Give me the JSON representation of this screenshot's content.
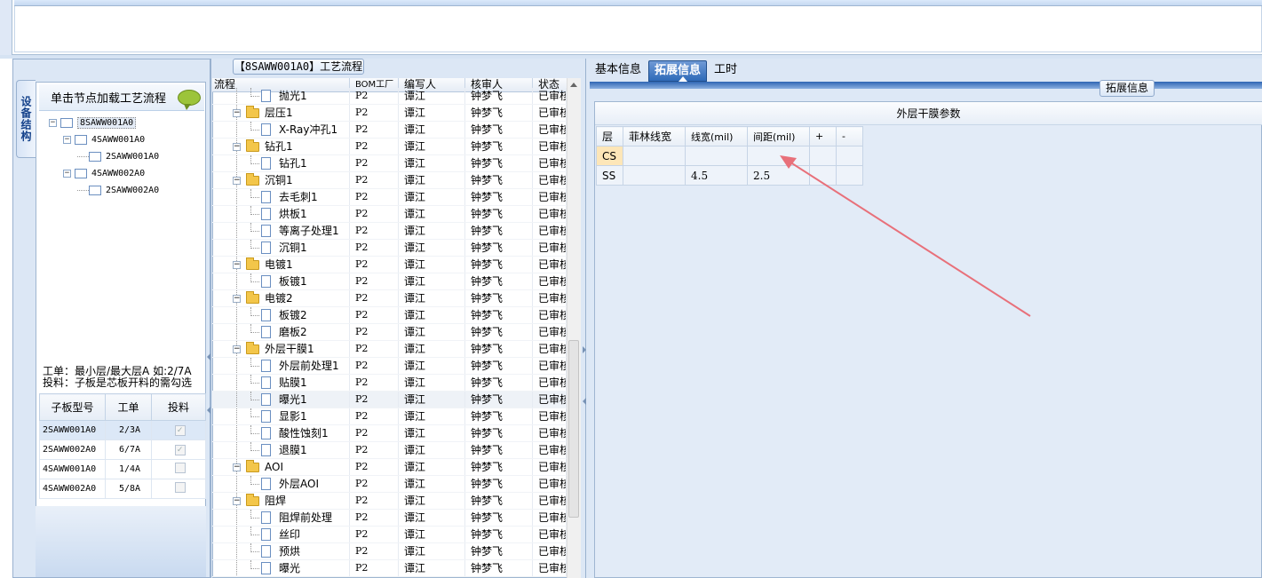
{
  "left_panel": {
    "vertical_tab": "设备结构",
    "tree_header": "单击节点加载工艺流程",
    "tree": [
      {
        "label": "8SAWW001A0",
        "level": 0,
        "expandable": true,
        "selected": true
      },
      {
        "label": "4SAWW001A0",
        "level": 1,
        "expandable": true
      },
      {
        "label": "2SAWW001A0",
        "level": 2,
        "expandable": false
      },
      {
        "label": "4SAWW002A0",
        "level": 1,
        "expandable": true
      },
      {
        "label": "2SAWW002A0",
        "level": 2,
        "expandable": false
      }
    ],
    "hint_line1": "工单：最小层/最大层A 如:2/7A",
    "hint_line2": "投料：子板是芯板开料的需勾选",
    "table_headers": [
      "子板型号",
      "工单",
      "投料"
    ],
    "table_rows": [
      {
        "model": "2SAWW001A0",
        "order": "2/3A",
        "checked": true,
        "selected": true
      },
      {
        "model": "2SAWW002A0",
        "order": "6/7A",
        "checked": true
      },
      {
        "model": "4SAWW001A0",
        "order": "1/4A",
        "checked": false
      },
      {
        "model": "4SAWW002A0",
        "order": "5/8A",
        "checked": false
      }
    ]
  },
  "middle_panel": {
    "title": "【8SAWW001A0】工艺流程",
    "headers": [
      "流程",
      "BOM工厂",
      "编写人",
      "核审人",
      "状态"
    ],
    "rows": [
      {
        "name": "抛光1",
        "level": 2,
        "folder": false,
        "bom": "P2",
        "writer": "谭江",
        "reviewer": "钟梦飞",
        "status": "已审核"
      },
      {
        "name": "层压1",
        "level": 1,
        "folder": true,
        "bom": "P2",
        "writer": "谭江",
        "reviewer": "钟梦飞",
        "status": "已审核"
      },
      {
        "name": "X-Ray冲孔1",
        "level": 2,
        "folder": false,
        "bom": "P2",
        "writer": "谭江",
        "reviewer": "钟梦飞",
        "status": "已审核"
      },
      {
        "name": "钻孔1",
        "level": 1,
        "folder": true,
        "bom": "P2",
        "writer": "谭江",
        "reviewer": "钟梦飞",
        "status": "已审核"
      },
      {
        "name": "钻孔1",
        "level": 2,
        "folder": false,
        "bom": "P2",
        "writer": "谭江",
        "reviewer": "钟梦飞",
        "status": "已审核"
      },
      {
        "name": "沉铜1",
        "level": 1,
        "folder": true,
        "bom": "P2",
        "writer": "谭江",
        "reviewer": "钟梦飞",
        "status": "已审核"
      },
      {
        "name": "去毛刺1",
        "level": 2,
        "folder": false,
        "bom": "P2",
        "writer": "谭江",
        "reviewer": "钟梦飞",
        "status": "已审核"
      },
      {
        "name": "烘板1",
        "level": 2,
        "folder": false,
        "bom": "P2",
        "writer": "谭江",
        "reviewer": "钟梦飞",
        "status": "已审核"
      },
      {
        "name": "等离子处理1",
        "level": 2,
        "folder": false,
        "bom": "P2",
        "writer": "谭江",
        "reviewer": "钟梦飞",
        "status": "已审核"
      },
      {
        "name": "沉铜1",
        "level": 2,
        "folder": false,
        "bom": "P2",
        "writer": "谭江",
        "reviewer": "钟梦飞",
        "status": "已审核"
      },
      {
        "name": "电镀1",
        "level": 1,
        "folder": true,
        "bom": "P2",
        "writer": "谭江",
        "reviewer": "钟梦飞",
        "status": "已审核"
      },
      {
        "name": "板镀1",
        "level": 2,
        "folder": false,
        "bom": "P2",
        "writer": "谭江",
        "reviewer": "钟梦飞",
        "status": "已审核"
      },
      {
        "name": "电镀2",
        "level": 1,
        "folder": true,
        "bom": "P2",
        "writer": "谭江",
        "reviewer": "钟梦飞",
        "status": "已审核"
      },
      {
        "name": "板镀2",
        "level": 2,
        "folder": false,
        "bom": "P2",
        "writer": "谭江",
        "reviewer": "钟梦飞",
        "status": "已审核"
      },
      {
        "name": "磨板2",
        "level": 2,
        "folder": false,
        "bom": "P2",
        "writer": "谭江",
        "reviewer": "钟梦飞",
        "status": "已审核"
      },
      {
        "name": "外层干膜1",
        "level": 1,
        "folder": true,
        "bom": "P2",
        "writer": "谭江",
        "reviewer": "钟梦飞",
        "status": "已审核"
      },
      {
        "name": "外层前处理1",
        "level": 2,
        "folder": false,
        "bom": "P2",
        "writer": "谭江",
        "reviewer": "钟梦飞",
        "status": "已审核"
      },
      {
        "name": "贴膜1",
        "level": 2,
        "folder": false,
        "bom": "P2",
        "writer": "谭江",
        "reviewer": "钟梦飞",
        "status": "已审核"
      },
      {
        "name": "曝光1",
        "level": 2,
        "folder": false,
        "bom": "P2",
        "writer": "谭江",
        "reviewer": "钟梦飞",
        "status": "已审核",
        "selected": true
      },
      {
        "name": "显影1",
        "level": 2,
        "folder": false,
        "bom": "P2",
        "writer": "谭江",
        "reviewer": "钟梦飞",
        "status": "已审核"
      },
      {
        "name": "酸性蚀刻1",
        "level": 2,
        "folder": false,
        "bom": "P2",
        "writer": "谭江",
        "reviewer": "钟梦飞",
        "status": "已审核"
      },
      {
        "name": "退膜1",
        "level": 2,
        "folder": false,
        "bom": "P2",
        "writer": "谭江",
        "reviewer": "钟梦飞",
        "status": "已审核"
      },
      {
        "name": "AOI",
        "level": 1,
        "folder": true,
        "bom": "P2",
        "writer": "谭江",
        "reviewer": "钟梦飞",
        "status": "已审核"
      },
      {
        "name": "外层AOI",
        "level": 2,
        "folder": false,
        "bom": "P2",
        "writer": "谭江",
        "reviewer": "钟梦飞",
        "status": "已审核"
      },
      {
        "name": "阻焊",
        "level": 1,
        "folder": true,
        "bom": "P2",
        "writer": "谭江",
        "reviewer": "钟梦飞",
        "status": "已审核"
      },
      {
        "name": "阻焊前处理",
        "level": 2,
        "folder": false,
        "bom": "P2",
        "writer": "谭江",
        "reviewer": "钟梦飞",
        "status": "已审核"
      },
      {
        "name": "丝印",
        "level": 2,
        "folder": false,
        "bom": "P2",
        "writer": "谭江",
        "reviewer": "钟梦飞",
        "status": "已审核"
      },
      {
        "name": "预烘",
        "level": 2,
        "folder": false,
        "bom": "P2",
        "writer": "谭江",
        "reviewer": "钟梦飞",
        "status": "已审核"
      },
      {
        "name": "曝光",
        "level": 2,
        "folder": false,
        "bom": "P2",
        "writer": "谭江",
        "reviewer": "钟梦飞",
        "status": "已审核"
      }
    ]
  },
  "right_panel": {
    "tabs": [
      {
        "label": "基本信息",
        "active": false
      },
      {
        "label": "拓展信息",
        "active": true
      },
      {
        "label": "工时",
        "active": false
      }
    ],
    "title": "拓展信息",
    "group_header": "外层干膜参数",
    "table_headers": [
      "层",
      "菲林线宽",
      "线宽(mil)",
      "间距(mil)",
      "+",
      "-"
    ],
    "table_rows": [
      {
        "layer": "CS",
        "film": "",
        "width": "",
        "spacing": ""
      },
      {
        "layer": "SS",
        "film": "",
        "width": "4.5",
        "spacing": "2.5"
      }
    ],
    "annotation_color": "#e8707a"
  }
}
